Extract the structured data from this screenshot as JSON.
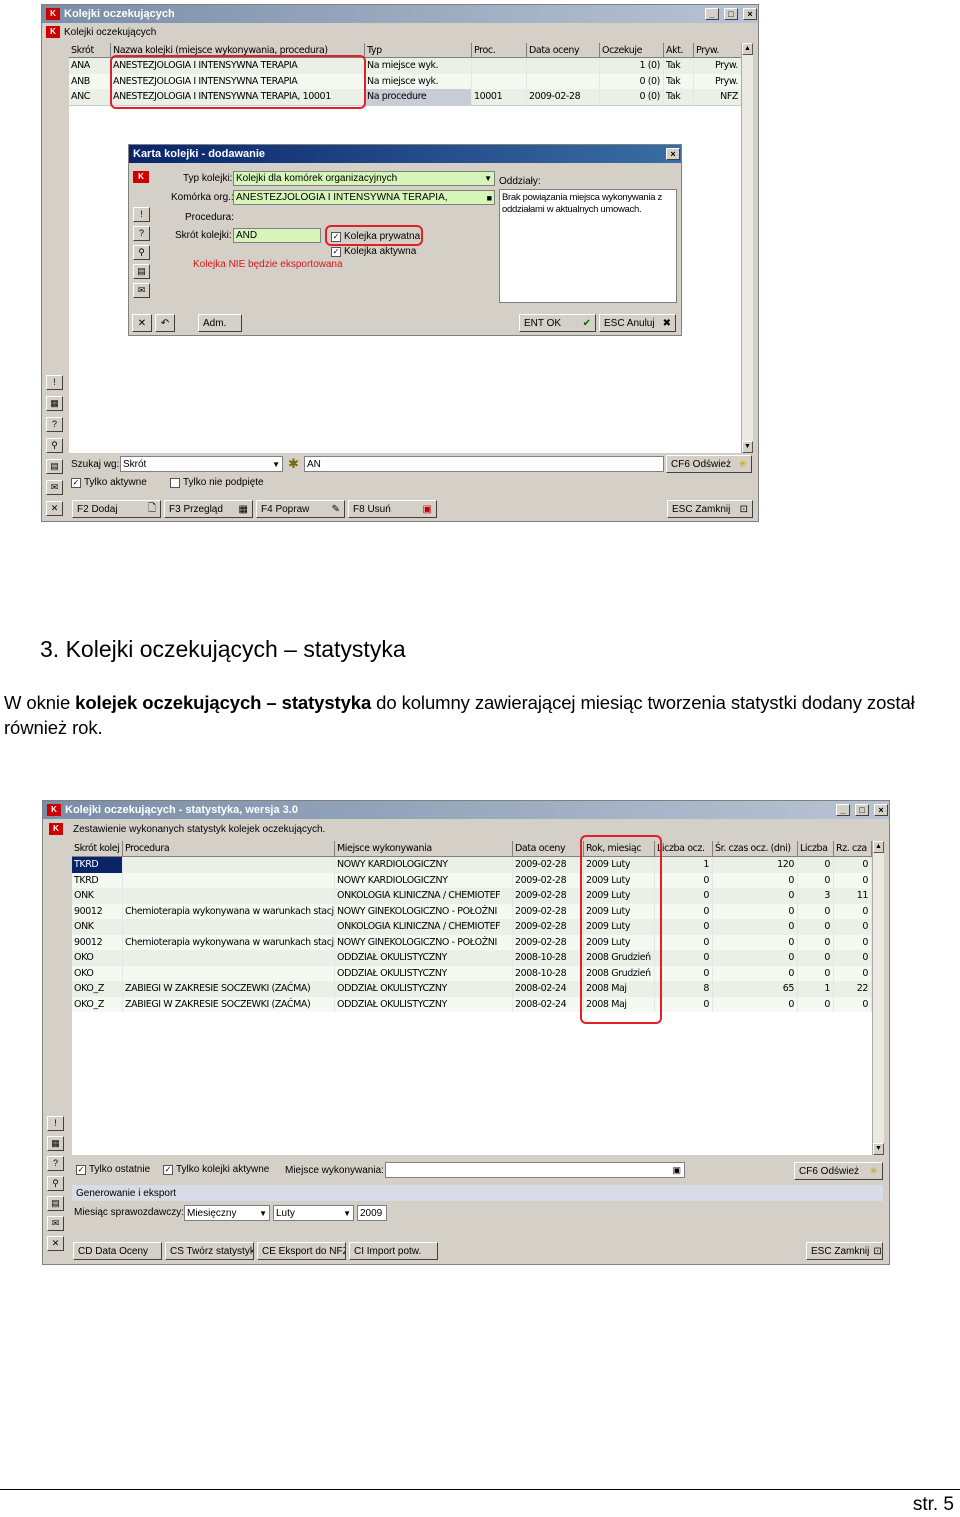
{
  "win1": {
    "title": "Kolejki oczekujących",
    "subtitle": "Kolejki oczekujących",
    "columns": [
      "Skrót",
      "Nazwa kolejki (miejsce wykonywania, procedura)",
      "Typ",
      "Proc.",
      "Data oceny",
      "Oczekuje",
      "Akt.",
      "Pryw."
    ],
    "rows": [
      [
        "ANA",
        "ANESTEZJOLOGIA I INTENSYWNA TERAPIA",
        "Na miejsce wyk.",
        "",
        "",
        "1 (0)",
        "Tak",
        "Pryw."
      ],
      [
        "ANB",
        "ANESTEZJOLOGIA I INTENSYWNA TERAPIA",
        "Na miejsce wyk.",
        "",
        "",
        "0 (0)",
        "Tak",
        "Pryw."
      ],
      [
        "ANC",
        "ANESTEZJOLOGIA I INTENSYWNA TERAPIA, 10001",
        "Na procedure",
        "10001",
        "2009-02-28",
        "0 (0)",
        "Tak",
        "NFZ"
      ]
    ],
    "search_label": "Szukaj wg:",
    "search_by": "Skrót",
    "search_value": "AN",
    "refresh": "CF6 Odśwież",
    "only_active": "Tylko aktywne",
    "only_unsigned": "Tylko nie podpięte",
    "buttons": [
      "F2 Dodaj",
      "F3 Przegląd",
      "F4 Popraw",
      "F8 Usuń"
    ],
    "close": "ESC Zamknij"
  },
  "dialog": {
    "title": "Karta kolejki - dodawanie",
    "type_label": "Typ kolejki:",
    "type_value": "Kolejki dla komórek organizacyjnych",
    "cell_label": "Komórka org.:",
    "cell_value": "ANESTEZJOLOGIA I INTENSYWNA TERAPIA,",
    "proc_label": "Procedura:",
    "short_label": "Skrót kolejki:",
    "short_value": "AND",
    "private": "Kolejka prywatna",
    "active": "Kolejka aktywna",
    "warn": "Kolejka NIE będzie eksportowana",
    "dept_label": "Oddziały:",
    "dept_text": "Brak powiązania miejsca wykonywania z oddziałami w aktualnych umowach.",
    "adm": "Adm.",
    "ok": "ENT OK",
    "cancel": "ESC Anuluj"
  },
  "heading": "3.  Kolejki oczekujących – statystyka",
  "para": {
    "p1": "W oknie ",
    "bold": "kolejek oczekujących – statystyka",
    "p2": " do kolumny zawierającej miesiąc tworzenia statystki dodany został również rok."
  },
  "win2": {
    "title": "Kolejki oczekujących - statystyka, wersja 3.0",
    "subtitle": "Zestawienie wykonanych statystyk kolejek oczekujących.",
    "columns": [
      "Skrót kolej",
      "Procedura",
      "Miejsce wykonywania",
      "Data oceny",
      "Rok, miesiąc",
      "Liczba ocz.",
      "Śr. czas ocz. (dni)",
      "Liczba",
      "Rz. cza"
    ],
    "rows": [
      [
        "TKRD",
        "",
        "NOWY KARDIOLOGICZNY",
        "2009-02-28",
        "2009 Luty",
        "1",
        "120",
        "0",
        "0"
      ],
      [
        "TKRD",
        "",
        "NOWY KARDIOLOGICZNY",
        "2009-02-28",
        "2009 Luty",
        "0",
        "0",
        "0",
        "0"
      ],
      [
        "ONK",
        "",
        "ONKOLOGIA KLINICZNA / CHEMIOTEF",
        "2009-02-28",
        "2009 Luty",
        "0",
        "0",
        "3",
        "11"
      ],
      [
        "90012",
        "Chemioterapia wykonywana w warunkach stacjo",
        "NOWY GINEKOLOGICZNO - POŁOŻNI",
        "2009-02-28",
        "2009 Luty",
        "0",
        "0",
        "0",
        "0"
      ],
      [
        "ONK",
        "",
        "ONKOLOGIA KLINICZNA / CHEMIOTEF",
        "2009-02-28",
        "2009 Luty",
        "0",
        "0",
        "0",
        "0"
      ],
      [
        "90012",
        "Chemioterapia wykonywana w warunkach stacjo",
        "NOWY GINEKOLOGICZNO - POŁOŻNI",
        "2009-02-28",
        "2009 Luty",
        "0",
        "0",
        "0",
        "0"
      ],
      [
        "OKO",
        "",
        "ODDZIAŁ OKULISTYCZNY",
        "2008-10-28",
        "2008 Grudzień",
        "0",
        "0",
        "0",
        "0"
      ],
      [
        "OKO",
        "",
        "ODDZIAŁ OKULISTYCZNY",
        "2008-10-28",
        "2008 Grudzień",
        "0",
        "0",
        "0",
        "0"
      ],
      [
        "OKO_Z",
        "ZABIEGI W ZAKRESIE SOCZEWKI (ZAĆMA)",
        "ODDZIAŁ OKULISTYCZNY",
        "2008-02-24",
        "2008 Maj",
        "8",
        "65",
        "1",
        "22"
      ],
      [
        "OKO_Z",
        "ZABIEGI W ZAKRESIE SOCZEWKI (ZAĆMA)",
        "ODDZIAŁ OKULISTYCZNY",
        "2008-02-24",
        "2008 Maj",
        "0",
        "0",
        "0",
        "0"
      ]
    ],
    "only_last": "Tylko ostatnie",
    "only_active": "Tylko kolejki aktywne",
    "place_label": "Miejsce wykonywania:",
    "refresh": "CF6 Odśwież",
    "gen_label": "Generowanie i eksport",
    "month_label": "Miesiąc sprawozdawczy:",
    "period": "Miesięczny",
    "month": "Luty",
    "year": "2009",
    "buttons": [
      "CD Data Oceny",
      "CS Twórz statystyki",
      "CE Eksport do NFZ",
      "CI Import potw."
    ],
    "close": "ESC Zamknij"
  },
  "page_no": "str. 5"
}
